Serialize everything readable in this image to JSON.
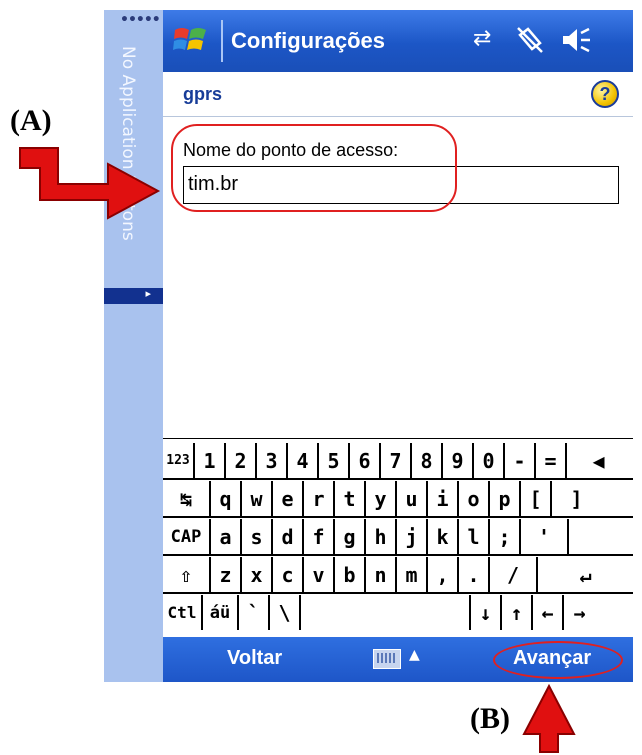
{
  "sidebar": {
    "dots": "•••••",
    "label": "No Application Buttons",
    "expand_glyph": "▸"
  },
  "titlebar": {
    "title": "Configurações",
    "icons": [
      "sync-arrows-icon",
      "no-phone-icon",
      "speaker-icon"
    ]
  },
  "subheader": {
    "name": "gprs",
    "help_icon": "?"
  },
  "form": {
    "label": "Nome do ponto de acesso:",
    "value": "tim.br"
  },
  "keyboard": {
    "rows": [
      [
        "123",
        "1",
        "2",
        "3",
        "4",
        "5",
        "6",
        "7",
        "8",
        "9",
        "0",
        "-",
        "=",
        "◀"
      ],
      [
        "↹",
        "q",
        "w",
        "e",
        "r",
        "t",
        "y",
        "u",
        "i",
        "o",
        "p",
        "[",
        "]"
      ],
      [
        "CAP",
        "a",
        "s",
        "d",
        "f",
        "g",
        "h",
        "j",
        "k",
        "l",
        ";",
        "'"
      ],
      [
        "⇧",
        "z",
        "x",
        "c",
        "v",
        "b",
        "n",
        "m",
        ",",
        ".",
        "/",
        "↵"
      ],
      [
        "Ctl",
        "áü",
        "`",
        "\\",
        "",
        "↓",
        "↑",
        "←",
        "→"
      ]
    ]
  },
  "bottombar": {
    "left": "Voltar",
    "right": "Avançar",
    "sip_arrow": "▲"
  },
  "annotations": {
    "a": "(A)",
    "b": "(B)"
  },
  "colors": {
    "titlebar": "#1c56c6",
    "sidebar": "#a9c2ee",
    "highlight": "#e02020",
    "arrow": "#e01010"
  }
}
